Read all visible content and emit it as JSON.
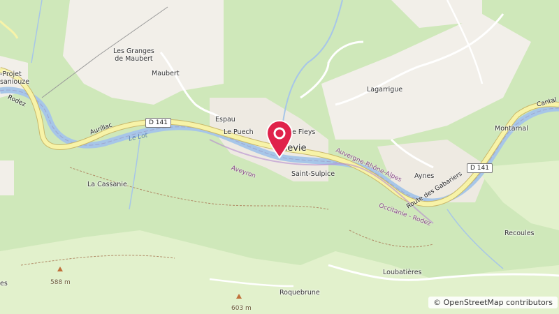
{
  "map": {
    "places": [
      {
        "key": "projet",
        "text": "-Projet\nsaniouze"
      },
      {
        "key": "granges",
        "text": "Les Granges\nde Maubert"
      },
      {
        "key": "maubert",
        "text": "Maubert"
      },
      {
        "key": "espau",
        "text": "Espau"
      },
      {
        "key": "lepuech",
        "text": "Le Puech"
      },
      {
        "key": "lefleys",
        "text": "e Fleys"
      },
      {
        "key": "vievie",
        "text": "lievie"
      },
      {
        "key": "lagarrigue",
        "text": "Lagarrigue"
      },
      {
        "key": "saintsulpice",
        "text": "Saint-Sulpice"
      },
      {
        "key": "aynes",
        "text": "Aynes"
      },
      {
        "key": "montarnal",
        "text": "Montarnal"
      },
      {
        "key": "lacassanie",
        "text": "La Cassanie"
      },
      {
        "key": "recoules",
        "text": "Recoules"
      },
      {
        "key": "loubatieres",
        "text": "Loubatières"
      },
      {
        "key": "roquebrune",
        "text": "Roquebrune"
      },
      {
        "key": "es",
        "text": "es"
      }
    ],
    "roads": {
      "d141_a": "D 141",
      "d141_b": "D 141",
      "aurillac": "Aurillac",
      "gabariers": "Route des Gabariers",
      "rodez_left": "Rodez",
      "cantal": "Cantal"
    },
    "water": {
      "lelot": "Le Lot"
    },
    "boundaries": {
      "aveyron": "Aveyron",
      "auvergne": "Auvergne-Rhône-Alpes",
      "occitanie": "Occitanie - Rodez"
    },
    "peaks": {
      "p588": "588 m",
      "p603": "603 m"
    }
  },
  "attribution": {
    "symbol": "©",
    "link": "OpenStreetMap contributors"
  },
  "marker": {
    "color": "#e0224a"
  },
  "colors": {
    "forest": "#cfe8ba",
    "meadow": "#e2f1cc",
    "open": "#f2efe9",
    "river": "#a7c6e8",
    "road": "#f7f3a8"
  }
}
